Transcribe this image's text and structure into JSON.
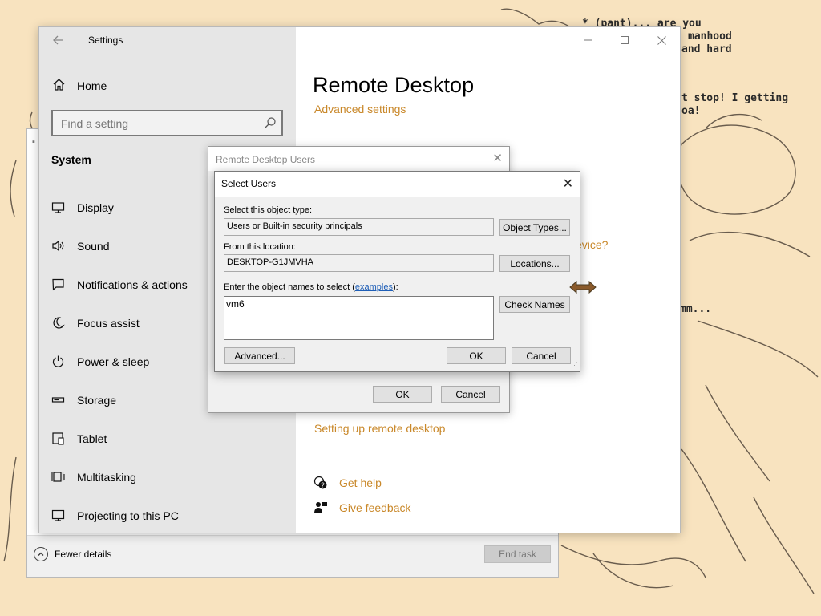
{
  "wallpaper": {
    "lines": [
      "* (pant)... are you",
      "manhood",
      "and hard",
      "t stop! I getting",
      "oa!",
      "mm..."
    ]
  },
  "task_manager": {
    "fewer_details": "Fewer details",
    "end_task": "End task"
  },
  "settings": {
    "title": "Settings",
    "home": "Home",
    "search_placeholder": "Find a setting",
    "section": "System",
    "nav": [
      {
        "label": "Display",
        "icon": "display-icon"
      },
      {
        "label": "Sound",
        "icon": "sound-icon"
      },
      {
        "label": "Notifications & actions",
        "icon": "notifications-icon"
      },
      {
        "label": "Focus assist",
        "icon": "moon-icon"
      },
      {
        "label": "Power & sleep",
        "icon": "power-icon"
      },
      {
        "label": "Storage",
        "icon": "storage-icon"
      },
      {
        "label": "Tablet",
        "icon": "tablet-icon"
      },
      {
        "label": "Multitasking",
        "icon": "multitasking-icon"
      },
      {
        "label": "Projecting to this PC",
        "icon": "projecting-icon"
      }
    ],
    "page_title": "Remote Desktop",
    "advanced_settings": "Advanced settings",
    "fragment_colon": ":",
    "fragment_device": "evice?",
    "setup_link": "Setting up remote desktop",
    "get_help": "Get help",
    "give_feedback": "Give feedback",
    "accent_color": "#c9882a"
  },
  "rdu_dialog": {
    "title": "Remote Desktop Users",
    "ok": "OK",
    "cancel": "Cancel"
  },
  "select_users": {
    "title": "Select Users",
    "object_type_label": "Select this object type:",
    "object_type_value": "Users or Built-in security principals",
    "object_types_button": "Object Types...",
    "location_label": "From this location:",
    "location_value": "DESKTOP-G1JMVHA",
    "locations_button": "Locations...",
    "names_label_prefix": "Enter the object names to select (",
    "names_label_link": "examples",
    "names_label_suffix": "):",
    "names_value": "vm6",
    "check_names_button": "Check Names",
    "advanced_button": "Advanced...",
    "ok": "OK",
    "cancel": "Cancel"
  }
}
